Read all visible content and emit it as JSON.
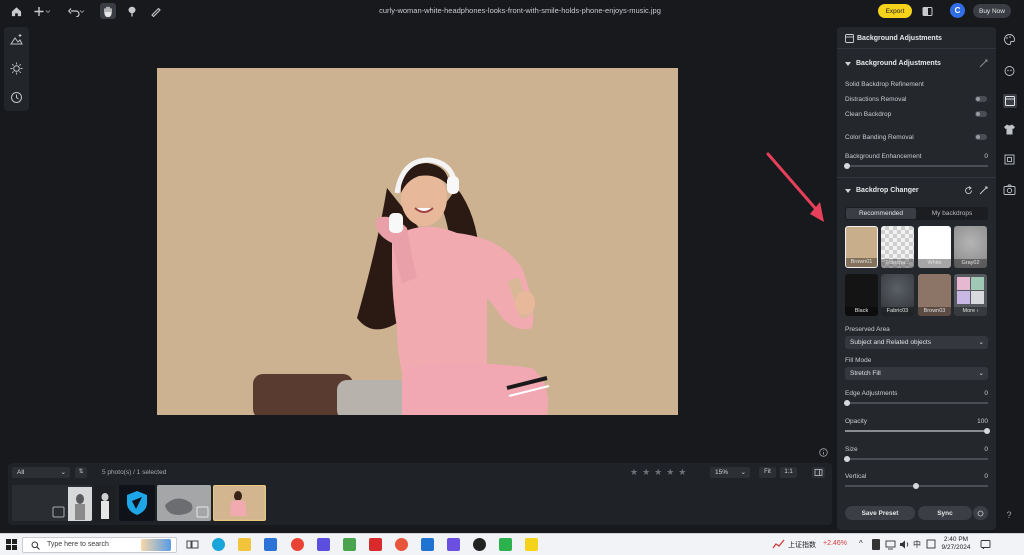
{
  "topbar": {
    "filename": "curly-woman-white-headphones-looks-front-with-smile-holds-phone-enjoys-music.jpg",
    "export_label": "Export",
    "avatar_letter": "C",
    "buy_label": "Buy Now"
  },
  "right_panel": {
    "header_title": "Background Adjustments",
    "bg_section_title": "Background Adjustments",
    "solid_backdrop_refinement": "Solid Backdrop Refinement",
    "distractions_removal": "Distractions Removal",
    "clean_backdrop": "Clean Backdrop",
    "color_banding_removal": "Color Banding Removal",
    "background_enhancement": "Background Enhancement",
    "background_enhancement_value": "0",
    "backdrop_changer_title": "Backdrop Changer",
    "tab_recommended": "Recommended",
    "tab_my_backdrops": "My backdrops",
    "backdrops": [
      {
        "label": "Brown01",
        "color": "#c9ae8c"
      },
      {
        "label": "Transpa...",
        "color": "checker"
      },
      {
        "label": "White",
        "color": "#ffffff"
      },
      {
        "label": "Gray02",
        "color": "#9a9a9a"
      },
      {
        "label": "Black",
        "color": "#141414"
      },
      {
        "label": "Fabric03",
        "color": "#3e4246"
      },
      {
        "label": "Brown03",
        "color": "#8c7467"
      },
      {
        "label": "More",
        "color": "multi"
      }
    ],
    "preserved_area_label": "Preserved Area",
    "preserved_area_value": "Subject and Related objects",
    "fill_mode_label": "Fill Mode",
    "fill_mode_value": "Stretch Fill",
    "edge_adjustments_label": "Edge Adjustments",
    "edge_adjustments_value": "0",
    "opacity_label": "Opacity",
    "opacity_value": "100",
    "size_label": "Size",
    "size_value": "0",
    "vertical_label": "Vertical",
    "vertical_value": "0",
    "save_preset_label": "Save Preset",
    "sync_label": "Sync"
  },
  "filmstrip": {
    "filter_value": "All",
    "photo_count": "5 photo(s) / 1 selected",
    "zoom_value": "15%",
    "fit_label": "Fit",
    "one_to_one_label": "1:1"
  },
  "taskbar": {
    "search_placeholder": "Type here to search",
    "stock_name": "上证指数",
    "stock_change": "+2.46%",
    "lang_indicator": "中",
    "time": "2:40 PM",
    "date": "9/27/2024"
  },
  "colors": {
    "accent_yellow": "#f5d31b",
    "avatar_blue": "#2f6ee6",
    "arrow_red": "#e8405a",
    "photo_bg": "#ccb291"
  }
}
